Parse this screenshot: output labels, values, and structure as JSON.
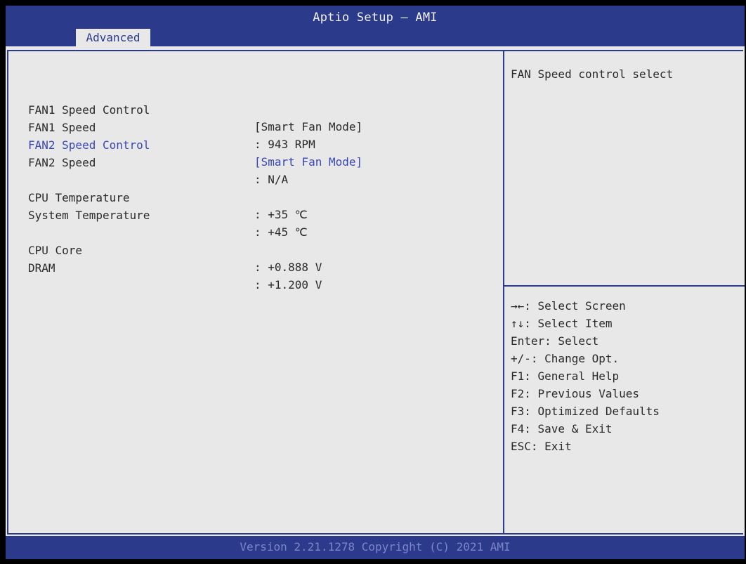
{
  "header": {
    "title": "Aptio Setup – AMI",
    "active_tab": "Advanced"
  },
  "settings": [
    {
      "label": "FAN1 Speed Control",
      "value": "[Smart Fan Mode]"
    },
    {
      "label": "FAN1 Speed",
      "value": ": 943 RPM"
    },
    {
      "label": "FAN2 Speed Control",
      "value": "[Smart Fan Mode]",
      "selected": true
    },
    {
      "label": "FAN2 Speed",
      "value": ": N/A"
    },
    {
      "label": "CPU Temperature",
      "value": ": +35 ℃"
    },
    {
      "label": "System Temperature",
      "value": ": +45 ℃"
    },
    {
      "label": "CPU Core",
      "value": ": +0.888 V"
    },
    {
      "label": "DRAM",
      "value": ": +1.200 V"
    }
  ],
  "help": {
    "description": "FAN Speed control select"
  },
  "key_help": [
    "→←: Select Screen",
    "↑↓: Select Item",
    "Enter: Select",
    "+/-: Change Opt.",
    "F1: General Help",
    "F2: Previous Values",
    "F3: Optimized Defaults",
    "F4: Save & Exit",
    "ESC: Exit"
  ],
  "footer": {
    "version": "Version 2.21.1278 Copyright (C) 2021 AMI"
  },
  "colors": {
    "bar": "#2c3a8c",
    "panel": "#e8e8e8",
    "text": "#2a2a2a",
    "selected": "#3a46b8"
  }
}
